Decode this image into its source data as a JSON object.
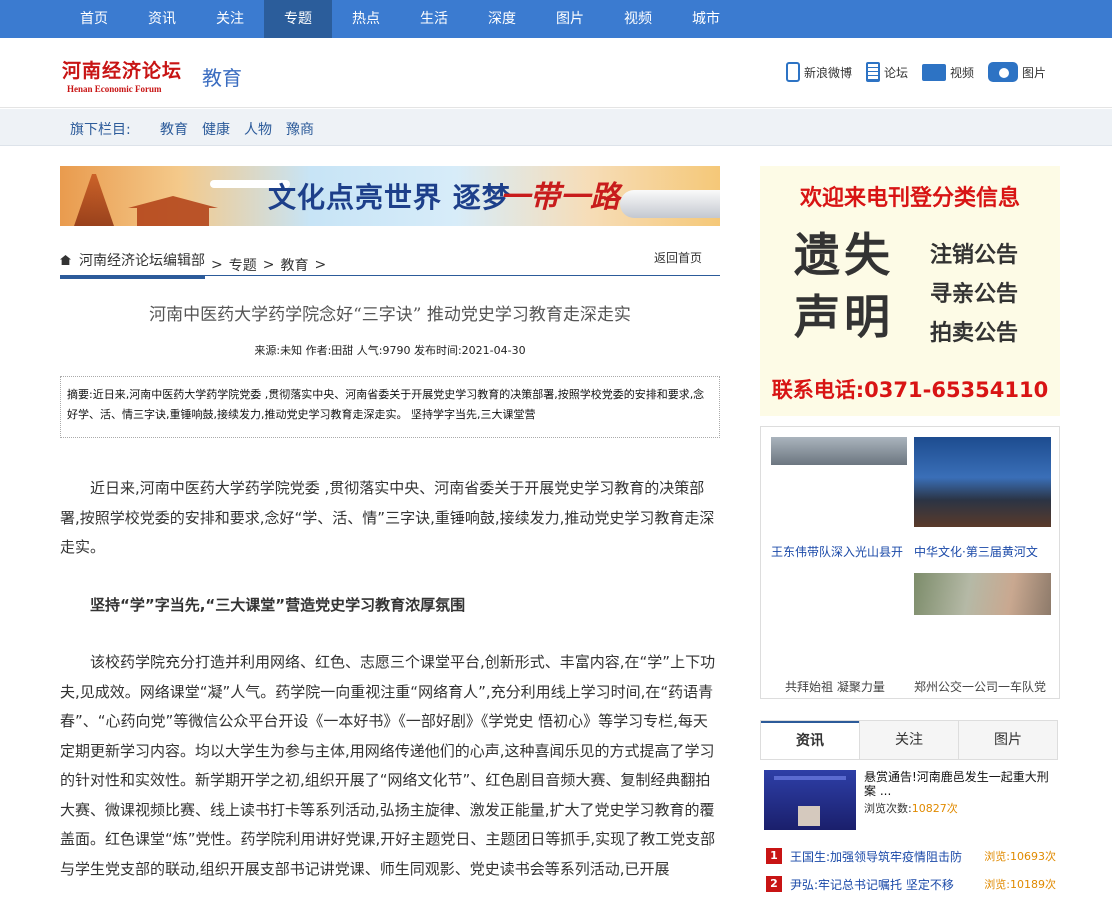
{
  "nav": {
    "items": [
      "首页",
      "资讯",
      "关注",
      "专题",
      "热点",
      "生活",
      "深度",
      "图片",
      "视频",
      "城市"
    ],
    "active_index": 3
  },
  "header": {
    "logo_cn": "河南经济论坛",
    "logo_en": "Henan Economic Forum",
    "channel": "教育",
    "links": [
      {
        "label": "新浪微博",
        "icon": "phone-icon"
      },
      {
        "label": "论坛",
        "icon": "forum-icon"
      },
      {
        "label": "视频",
        "icon": "monitor-icon"
      },
      {
        "label": "图片",
        "icon": "camera-icon"
      }
    ]
  },
  "subnav": {
    "label": "旗下栏目:",
    "links": [
      "教育",
      "健康",
      "人物",
      "豫商"
    ]
  },
  "banner": {
    "text1": "文化点亮世界  逐梦",
    "text2": "一带一路"
  },
  "breadcrumb": {
    "items": [
      "河南经济论坛编辑部",
      "专题",
      "教育"
    ],
    "back": "返回首页"
  },
  "article": {
    "title": "河南中医药大学药学院念好“三字诀” 推动党史学习教育走深走实",
    "meta": "来源:未知 作者:田甜 人气:9790 发布时间:2021-04-30",
    "summary": "摘要:近日来,河南中医药大学药学院党委 ,贯彻落实中央、河南省委关于开展党史学习教育的决策部署,按照学校党委的安排和要求,念好学、活、情三字诀,重锤响鼓,接续发力,推动党史学习教育走深走实。 坚持学字当先,三大课堂营",
    "p1": "近日来,河南中医药大学药学院党委 ,贯彻落实中央、河南省委关于开展党史学习教育的决策部署,按照学校党委的安排和要求,念好“学、活、情”三字诀,重锤响鼓,接续发力,推动党史学习教育走深走实。",
    "h1": "坚持“学”字当先,“三大课堂”营造党史学习教育浓厚氛围",
    "p2": "该校药学院充分打造并利用网络、红色、志愿三个课堂平台,创新形式、丰富内容,在“学”上下功夫,见成效。网络课堂“凝”人气。药学院一向重视注重“网络育人”,充分利用线上学习时间,在“药语青春”、“心药向党”等微信公众平台开设《一本好书》《一部好剧》《学党史 悟初心》等学习专栏,每天定期更新学习内容。均以大学生为参与主体,用网络传递他们的心声,这种喜闻乐见的方式提高了学习的针对性和实效性。新学期开学之初,组织开展了“网络文化节”、红色剧目音频大赛、复制经典翻拍大赛、微课视频比赛、线上读书打卡等系列活动,弘扬主旋律、激发正能量,扩大了党史学习教育的覆盖面。红色课堂“炼”党性。药学院利用讲好党课,开好主题党日、主题团日等抓手,实现了教工党支部与学生党支部的联动,组织开展支部书记讲党课、师生同观影、党史读书会等系列活动,已开展"
  },
  "ad": {
    "headline": "欢迎来电刊登分类信息",
    "big1": "遗失",
    "big2": "声明",
    "items": [
      "注销公告",
      "寻亲公告",
      "拍卖公告"
    ],
    "phone": "联系电话:0371-65354110"
  },
  "photos": [
    {
      "caption": "王东伟带队深入光山县开"
    },
    {
      "caption": "中华文化·第三届黄河文"
    },
    {
      "caption": "共拜始祖  凝聚力量"
    },
    {
      "caption": "郑州公交一公司一车队党"
    }
  ],
  "tabs": {
    "items": [
      "资讯",
      "关注",
      "图片"
    ],
    "active_index": 0
  },
  "featured": {
    "title": "悬赏通告!河南鹿邑发生一起重大刑案 ...",
    "views_label": "浏览次数:",
    "views": "10827次"
  },
  "ranks": [
    {
      "num": "1",
      "name": "王国生:",
      "text": "加强领导筑牢疫情阻击防",
      "views": "浏览:10693次"
    },
    {
      "num": "2",
      "name": "尹弘:",
      "text": "牢记总书记嘱托 坚定不移",
      "views": "浏览:10189次"
    }
  ]
}
